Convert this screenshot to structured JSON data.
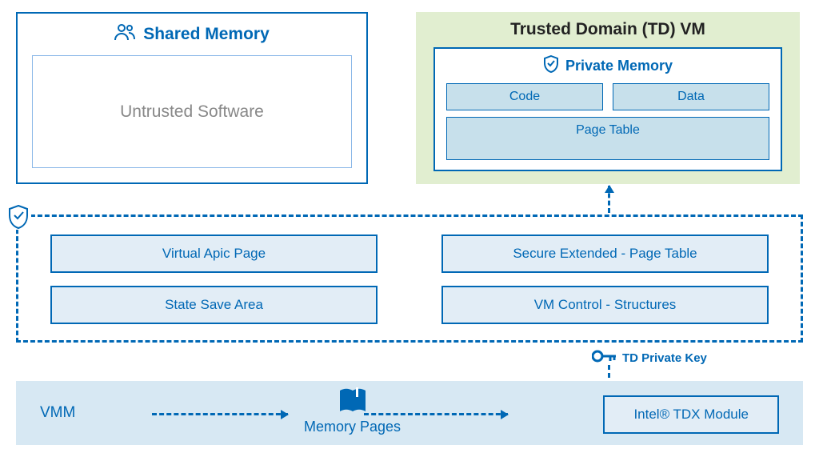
{
  "shared_memory": {
    "title": "Shared Memory",
    "untrusted": "Untrusted Software"
  },
  "td_vm": {
    "title": "Trusted Domain (TD) VM",
    "private_memory_title": "Private Memory",
    "code": "Code",
    "data": "Data",
    "page_table": "Page Table"
  },
  "trusted": {
    "virtual_apic": "Virtual Apic Page",
    "state_save": "State Save Area",
    "secure_ept": "Secure Extended - Page Table",
    "vmcs": "VM Control - Structures"
  },
  "bottom": {
    "vmm": "VMM",
    "memory_pages": "Memory Pages",
    "tdx_module": "Intel® TDX Module",
    "td_private_key": "TD Private Key"
  }
}
